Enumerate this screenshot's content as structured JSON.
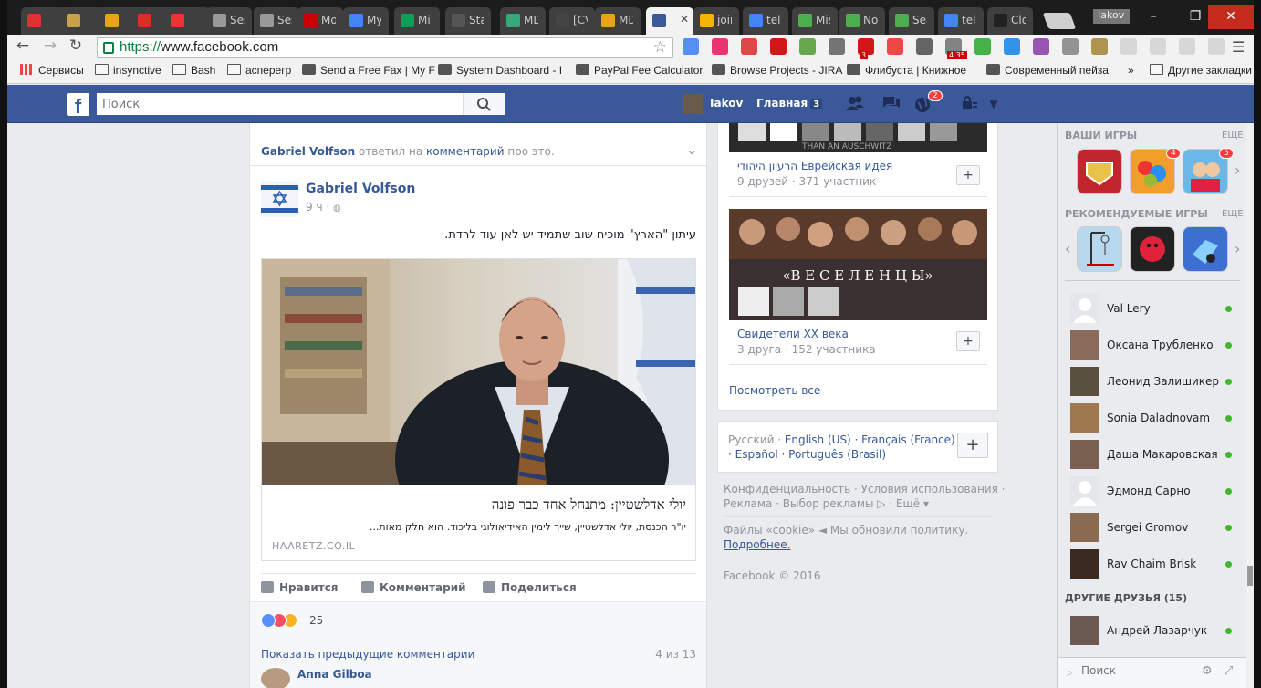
{
  "browser": {
    "tabs": [
      {
        "label": "",
        "color": "#d33"
      },
      {
        "label": "",
        "color": "#c8a24a"
      },
      {
        "label": "",
        "color": "#e8a317"
      },
      {
        "label": "",
        "color": "#d93025"
      },
      {
        "label": "",
        "color": "#e33"
      },
      {
        "label": "Ses",
        "color": "#999"
      },
      {
        "label": "Ses",
        "color": "#999"
      },
      {
        "label": "Mo",
        "color": "#c00"
      },
      {
        "label": "My",
        "color": "#4285f4"
      },
      {
        "label": "Mi",
        "color": "#0f9d58"
      },
      {
        "label": "Star",
        "color": "#555"
      },
      {
        "label": "MD",
        "color": "#3a7"
      },
      {
        "label": "[CV",
        "color": "#444"
      },
      {
        "label": "MD",
        "color": "#e8a317"
      },
      {
        "label": "",
        "color": "#3b5998"
      },
      {
        "label": "join",
        "color": "#f4b400"
      },
      {
        "label": "tele",
        "color": "#4285f4"
      },
      {
        "label": "Mis",
        "color": "#4caf50"
      },
      {
        "label": "No",
        "color": "#4caf50"
      },
      {
        "label": "Sea",
        "color": "#4caf50"
      },
      {
        "label": "tele",
        "color": "#4285f4"
      },
      {
        "label": "Clo",
        "color": "#222"
      }
    ],
    "user_badge": "Iakov",
    "url_scheme": "https://",
    "url_host": "www.facebook.com",
    "bookmarks": [
      {
        "label": "Сервисы",
        "icon": "apps-grid-icon"
      },
      {
        "label": "insynctive",
        "icon": "folder-icon"
      },
      {
        "label": "Bash",
        "icon": "folder-icon"
      },
      {
        "label": "асперегр",
        "icon": "folder-icon"
      },
      {
        "label": "Send a Free Fax | My F",
        "icon": "fax-icon"
      },
      {
        "label": "System Dashboard - I",
        "icon": "jira-icon"
      },
      {
        "label": "PayPal Fee Calculator",
        "icon": "calc-icon"
      },
      {
        "label": "Browse Projects - JIRA",
        "icon": "jira-icon"
      },
      {
        "label": "Флибуста | Книжное",
        "icon": "book-icon"
      },
      {
        "label": "Современный пейза",
        "icon": "paint-icon"
      },
      {
        "label": "»",
        "icon": ""
      },
      {
        "label": "Другие закладки",
        "icon": "folder-icon"
      }
    ],
    "ext_badge_1": "3",
    "ext_badge_2": "4.35"
  },
  "fb": {
    "search_placeholder": "Поиск",
    "user_name": "Iakov",
    "home_label": "Главная",
    "home_count": "3",
    "notif_count": "2"
  },
  "post": {
    "shared_actor": "Gabriel Volfson",
    "shared_middle": " ответил на ",
    "shared_link": "комментарий",
    "shared_end": " про это.",
    "author": "Gabriel Volfson",
    "time": "9 ч",
    "text": "עיתון \"הארץ\" מוכיח שוב שתמיד יש לאן עוד לרדת.",
    "link_title": "יולי אדלשטיין: מתנחל אחד כבר פונה",
    "link_desc": "יו\"ר הכנסת, יולי אדלשטיין, שייך לימין האידיאולוגי בליכוד. הוא חלק מאות...",
    "link_source": "HAARETZ.CO.IL",
    "like_label": "Нравится",
    "comment_label": "Комментарий",
    "share_label": "Поделиться",
    "reactions_count": "25",
    "prev_comments": "Показать предыдущие комментарии",
    "comments_page": "4 из 13",
    "commenter": "Anna Gilboa"
  },
  "groups": [
    {
      "title": "הרעיון היהודי Еврейская идея",
      "sub": "9 друзей · 371 участник",
      "banner": "THAN AN AUSCHWITZ"
    },
    {
      "title": "Свидетели XX века",
      "sub": "3 друга · 152 участника",
      "banner": "«В Е С Е Л Е Н Ц Ы»"
    }
  ],
  "groups_see_all": "Посмотреть все",
  "languages": {
    "current": "Русский · ",
    "others": "English (US) · Français (France) · Español · Português (Brasil)"
  },
  "footer": {
    "line1": "Конфиденциальность · Условия использования ·",
    "line2": "Реклама · Выбор рекламы ▷ · Ещё ▾",
    "cookie1": "Файлы «cookie» ◄ Мы обновили политику.",
    "cookie2": "Подробнее.",
    "copyright": "Facebook © 2016"
  },
  "sidebar": {
    "your_games": "ВАШИ ИГРЫ",
    "more": "ЕЩЕ",
    "recommended": "РЕКОМЕНДУЕМЫЕ ИГРЫ",
    "game_badge_1": "4",
    "game_badge_2": "5",
    "friends": [
      {
        "name": "Val Lery",
        "online": true
      },
      {
        "name": "Оксана Трубленко",
        "online": true
      },
      {
        "name": "Леонид Залишикер",
        "online": true
      },
      {
        "name": "Sonia Daladnovam",
        "online": true
      },
      {
        "name": "Даша Макаровская",
        "online": true
      },
      {
        "name": "Эдмонд Сарно",
        "online": true
      },
      {
        "name": "Sergei Gromov",
        "online": true
      },
      {
        "name": "Rav Chaim Brisk",
        "online": true
      }
    ],
    "other_friends": "ДРУГИЕ ДРУЗЬЯ (15)",
    "other_friend": "Андрей Лазарчук",
    "search_placeholder": "Поиск"
  },
  "colors": {
    "fb_blue": "#3b5998",
    "link": "#365899",
    "online": "#42b72a"
  }
}
